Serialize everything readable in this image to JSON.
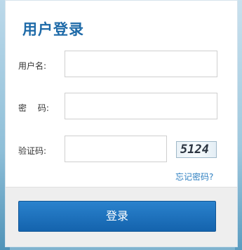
{
  "form": {
    "title": "用户登录",
    "username": {
      "label": "用户名:",
      "value": "",
      "placeholder": ""
    },
    "password": {
      "label": "密　 码:",
      "value": "",
      "placeholder": ""
    },
    "captcha": {
      "label": "验证码:",
      "value": "",
      "placeholder": "",
      "image_text": "5124"
    },
    "forgot_password": "忘记密码?",
    "login_button": "登录"
  },
  "colors": {
    "title": "#1e6aa8",
    "button": "#1a6fbe",
    "link": "#2d7fc1"
  }
}
